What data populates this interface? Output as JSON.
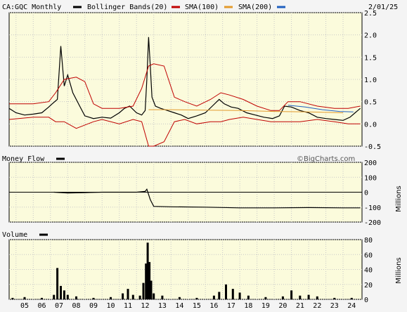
{
  "header": {
    "symbol_text": "CA:GQC Monthly",
    "legend": [
      {
        "label": "Bollinger Bands(20)",
        "color": "#000000"
      },
      {
        "label": "SMA(100)",
        "color": "#c00000"
      },
      {
        "label": "SMA(200)",
        "color": "#e39a2c"
      },
      {
        "label": "",
        "color": "#1f5fbf"
      }
    ],
    "date": "2/01/25"
  },
  "credit": "©BigCharts.com",
  "x_ticks": [
    "05",
    "06",
    "07",
    "08",
    "09",
    "10",
    "11",
    "12",
    "13",
    "14",
    "15",
    "16",
    "17",
    "18",
    "19",
    "20",
    "21",
    "22",
    "23",
    "24"
  ],
  "chart_data": [
    {
      "type": "line",
      "panel": "price",
      "title": "CA:GQC Monthly",
      "ylim": [
        -0.5,
        2.5
      ],
      "yticks": [
        "2.5",
        "2.0",
        "1.5",
        "1.0",
        "0.5",
        "0.0",
        "-0.5"
      ],
      "ytick_values": [
        2.5,
        2.0,
        1.5,
        1.0,
        0.5,
        0.0,
        -0.5
      ],
      "x_start": 2004.6,
      "x_end": 2025.1,
      "series": [
        {
          "name": "",
          "role": "price",
          "color": "#000000",
          "x": [
            2004.6,
            2005.0,
            2005.5,
            2006.0,
            2006.5,
            2006.9,
            2007.1,
            2007.4,
            2007.6,
            2007.8,
            2008.0,
            2008.3,
            2008.7,
            2009.0,
            2009.5,
            2010.0,
            2010.5,
            2011.0,
            2011.3,
            2011.6,
            2012.0,
            2012.3,
            2012.5,
            2012.6,
            2012.7,
            2012.8,
            2012.9,
            2013.1,
            2013.4,
            2013.8,
            2014.2,
            2014.6,
            2015.0,
            2015.5,
            2016.0,
            2016.4,
            2016.8,
            2017.1,
            2017.5,
            2017.9,
            2018.4,
            2018.9,
            2019.4,
            2019.9,
            2020.3,
            2020.6,
            2021.0,
            2021.5,
            2022.0,
            2022.5,
            2023.0,
            2023.5,
            2024.0,
            2024.4,
            2024.7,
            2025.0
          ],
          "y": [
            0.35,
            0.25,
            0.2,
            0.22,
            0.25,
            0.38,
            0.45,
            0.55,
            1.75,
            0.85,
            1.1,
            0.7,
            0.4,
            0.18,
            0.12,
            0.15,
            0.13,
            0.25,
            0.35,
            0.4,
            0.25,
            0.2,
            0.3,
            1.0,
            1.95,
            1.3,
            0.6,
            0.4,
            0.35,
            0.3,
            0.25,
            0.2,
            0.12,
            0.18,
            0.25,
            0.4,
            0.55,
            0.45,
            0.38,
            0.35,
            0.25,
            0.2,
            0.15,
            0.12,
            0.18,
            0.4,
            0.38,
            0.3,
            0.25,
            0.15,
            0.12,
            0.1,
            0.08,
            0.15,
            0.25,
            0.35
          ]
        },
        {
          "name": "",
          "role": "bollinger-upper",
          "color": "#c00000",
          "x": [
            2004.6,
            2006.0,
            2006.9,
            2007.3,
            2007.8,
            2008.5,
            2009.0,
            2009.5,
            2010.0,
            2011.0,
            2011.8,
            2012.3,
            2012.7,
            2013.0,
            2013.6,
            2014.2,
            2014.8,
            2015.5,
            2016.3,
            2016.9,
            2017.4,
            2018.2,
            2019.0,
            2019.8,
            2020.3,
            2020.8,
            2021.5,
            2022.5,
            2023.5,
            2024.3,
            2025.0
          ],
          "y": [
            0.45,
            0.45,
            0.5,
            0.7,
            1.0,
            1.05,
            0.95,
            0.45,
            0.35,
            0.35,
            0.4,
            0.8,
            1.3,
            1.35,
            1.3,
            0.6,
            0.5,
            0.4,
            0.55,
            0.7,
            0.65,
            0.55,
            0.4,
            0.3,
            0.3,
            0.5,
            0.5,
            0.4,
            0.35,
            0.35,
            0.4
          ]
        },
        {
          "name": "",
          "role": "bollinger-lower",
          "color": "#c00000",
          "x": [
            2004.6,
            2006.0,
            2006.9,
            2007.3,
            2007.8,
            2008.5,
            2009.5,
            2010.0,
            2011.0,
            2011.8,
            2012.3,
            2012.7,
            2013.0,
            2013.6,
            2014.2,
            2014.8,
            2015.5,
            2016.3,
            2016.9,
            2017.4,
            2018.2,
            2019.0,
            2019.8,
            2020.3,
            2020.8,
            2021.5,
            2022.5,
            2023.5,
            2024.3,
            2025.0
          ],
          "y": [
            0.1,
            0.15,
            0.15,
            0.05,
            0.05,
            -0.1,
            0.05,
            0.1,
            0.0,
            0.1,
            0.05,
            -0.5,
            -0.5,
            -0.4,
            0.05,
            0.1,
            0.0,
            0.05,
            0.05,
            0.1,
            0.15,
            0.1,
            0.05,
            0.05,
            0.05,
            0.05,
            0.1,
            0.05,
            0.0,
            0.0
          ]
        },
        {
          "name": "",
          "role": "sma100",
          "color": "#e39a2c",
          "x": [
            2012.7,
            2014.0,
            2016.0,
            2018.0,
            2020.0,
            2022.0,
            2024.0
          ],
          "y": [
            0.32,
            0.32,
            0.31,
            0.3,
            0.28,
            0.27,
            0.25
          ]
        },
        {
          "name": "",
          "role": "sma200",
          "color": "#1f5fbf",
          "x": [
            2020.8,
            2021.8,
            2022.8,
            2023.8,
            2024.6
          ],
          "y": [
            0.42,
            0.38,
            0.32,
            0.28,
            0.27
          ]
        }
      ]
    },
    {
      "type": "line",
      "panel": "money-flow",
      "title": "Money Flow",
      "ylabel": "Millions",
      "ylim": [
        -200,
        200
      ],
      "yticks": [
        "200",
        "100",
        "0",
        "-100",
        "-200"
      ],
      "ytick_values": [
        200,
        100,
        0,
        -100,
        -200
      ],
      "series": [
        {
          "name": "",
          "color": "#000000",
          "x": [
            2007.2,
            2008.0,
            2009.0,
            2010.0,
            2011.0,
            2012.0,
            2012.5,
            2012.6,
            2012.8,
            2013.0,
            2014.0,
            2016.0,
            2018.0,
            2020.0,
            2022.0,
            2024.0,
            2025.0
          ],
          "y": [
            0,
            -5,
            -3,
            0,
            0,
            0,
            5,
            20,
            -50,
            -95,
            -98,
            -100,
            -105,
            -105,
            -103,
            -105,
            -105
          ]
        }
      ]
    },
    {
      "type": "bar",
      "panel": "volume",
      "title": "Volume",
      "ylabel": "Millions",
      "ylim": [
        0,
        80
      ],
      "yticks": [
        "80",
        "60",
        "40",
        "20",
        "0"
      ],
      "ytick_values": [
        80,
        60,
        40,
        20,
        0
      ],
      "x": [
        2004.8,
        2005.5,
        2006.5,
        2007.2,
        2007.4,
        2007.6,
        2007.8,
        2008.0,
        2008.5,
        2009.5,
        2010.5,
        2011.2,
        2011.5,
        2011.8,
        2012.2,
        2012.4,
        2012.55,
        2012.65,
        2012.75,
        2012.85,
        2013.0,
        2013.5,
        2014.5,
        2015.5,
        2016.5,
        2016.8,
        2017.2,
        2017.6,
        2018.0,
        2018.5,
        2019.5,
        2020.5,
        2021.0,
        2021.5,
        2022.0,
        2022.5,
        2023.5,
        2024.5
      ],
      "values": [
        2,
        3,
        2,
        6,
        42,
        18,
        12,
        6,
        4,
        2,
        3,
        8,
        14,
        6,
        5,
        22,
        48,
        76,
        50,
        25,
        8,
        5,
        3,
        2,
        5,
        10,
        20,
        14,
        9,
        5,
        3,
        4,
        12,
        5,
        6,
        4,
        2,
        2
      ]
    }
  ]
}
